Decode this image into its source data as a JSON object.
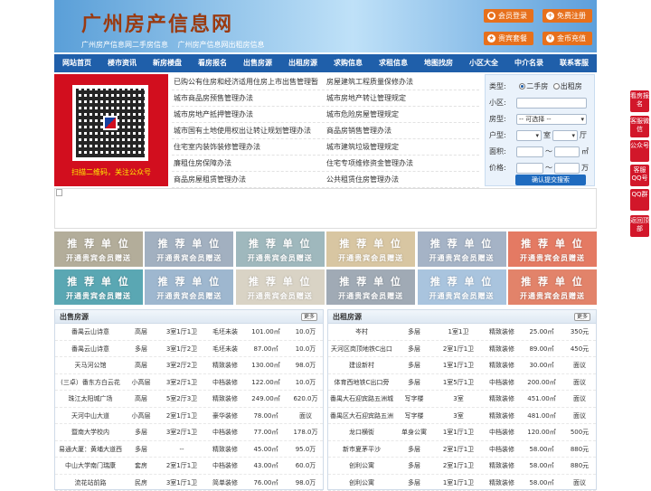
{
  "header": {
    "logo": "广州房产信息网",
    "slogans": [
      "广州房产信息网二手房信息",
      "广州房产信息网出租房信息"
    ],
    "buttons": [
      {
        "label": "会员登录",
        "icon": "user-icon"
      },
      {
        "label": "免费注册",
        "icon": "register-icon"
      },
      {
        "label": "贵宾套餐",
        "icon": "vip-icon"
      },
      {
        "label": "金币充值",
        "icon": "coin-icon"
      }
    ],
    "accent": "#e7701c"
  },
  "nav": [
    "网站首页",
    "楼市资讯",
    "新房楼盘",
    "看房报名",
    "出售房源",
    "出租房源",
    "求购信息",
    "求租信息",
    "地图找房",
    "小区大全",
    "中介名录",
    "联系客服"
  ],
  "qr": {
    "caption": "扫描二维码，关注公众号"
  },
  "links": [
    [
      "已购公有住房和经济适用住房上市出售管理暂",
      "房屋建筑工程质量保修办法"
    ],
    [
      "城市商品房预售管理办法",
      "城市房地产转让管理规定"
    ],
    [
      "城市房地产抵押管理办法",
      "城市危险房屋管理规定"
    ],
    [
      "城市国有土地使用权出让转让规划管理办法",
      "商品房销售管理办法"
    ],
    [
      "住宅室内装饰装修管理办法",
      "城市建筑垃圾管理规定"
    ],
    [
      "廉租住房保障办法",
      "住宅专项维修资金管理办法"
    ],
    [
      "商品房屋租赁管理办法",
      "公共租赁住房管理办法"
    ]
  ],
  "search": {
    "type_label": "类型:",
    "opt1": "二手房",
    "opt2": "出租房",
    "community_label": "小区:",
    "housing_label": "房型:",
    "housing_value": "-- 可选择 --",
    "layout_label": "户型:",
    "room_unit": "室",
    "hall_unit": "厅",
    "area_label": "面积:",
    "area_sep": "～",
    "area_unit": "㎡",
    "price_label": "价格:",
    "price_sep": "～",
    "price_unit": "万",
    "submit": "确认提交搜索"
  },
  "promo": {
    "title": "推 荐 单 位",
    "subtitle": "开通贵宾会员赠送",
    "colors": [
      "#b3ad9a",
      "#a2b0c0",
      "#9fb8bd",
      "#d8c6a2",
      "#a5b3c6",
      "#e47a63",
      "#5aa7b3",
      "#9eb7cf",
      "#d9d3c5",
      "#a0aab5",
      "#a9c4de",
      "#e2836a"
    ]
  },
  "sale": {
    "title": "出售房源",
    "more": "更多",
    "rows": [
      [
        "番禺云山诗意",
        "高层",
        "3室1厅1卫",
        "毛坯未装",
        "101.00㎡",
        "10.0万"
      ],
      [
        "番禺云山诗意",
        "多层",
        "3室1厅2卫",
        "毛坯未装",
        "87.00㎡",
        "10.0万"
      ],
      [
        "天马河公馆",
        "高层",
        "3室2厅2卫",
        "精致装修",
        "130.00㎡",
        "98.0万"
      ],
      [
        "(三卓）番东方白云花",
        "小高层",
        "3室2厅1卫",
        "中档装修",
        "122.00㎡",
        "10.0万"
      ],
      [
        "珠江太阳城广场",
        "高层",
        "5室2厅3卫",
        "精致装修",
        "249.00㎡",
        "620.0万"
      ],
      [
        "天河中山大道",
        "小高层",
        "2室1厅1卫",
        "豪华装修",
        "78.00㎡",
        "面议"
      ],
      [
        "暨南大学校内",
        "多层",
        "3室2厅1卫",
        "中档装修",
        "77.00㎡",
        "178.0万"
      ],
      [
        "易通大厦：黄埔大道西",
        "多层",
        "--",
        "精致装修",
        "45.00㎡",
        "95.0万"
      ],
      [
        "中山大学南门瑞康",
        "套房",
        "2室1厅1卫",
        "中档装修",
        "43.00㎡",
        "60.0万"
      ],
      [
        "流花站前路",
        "民房",
        "3室1厅1卫",
        "简单装修",
        "76.00㎡",
        "98.0万"
      ]
    ]
  },
  "rent": {
    "title": "出租房源",
    "more": "更多",
    "rows": [
      [
        "岑村",
        "多层",
        "1室1卫",
        "精致装修",
        "25.00㎡",
        "350元"
      ],
      [
        "天河区岗顶地铁C出口",
        "多层",
        "2室1厅1卫",
        "精致装修",
        "89.00㎡",
        "450元"
      ],
      [
        "建设新村",
        "多层",
        "1室1厅1卫",
        "精致装修",
        "30.00㎡",
        "面议"
      ],
      [
        "体育西地铁C出口旁",
        "多层",
        "1室5厅1卫",
        "中档装修",
        "200.00㎡",
        "面议"
      ],
      [
        "番禺大石迎宾路五洲城",
        "写字楼",
        "3室",
        "精致装修",
        "451.00㎡",
        "面议"
      ],
      [
        "番禺区大石迎宾路五洲",
        "写字楼",
        "3室",
        "精致装修",
        "481.00㎡",
        "面议"
      ],
      [
        "龙口横街",
        "单身公寓",
        "1室1厅1卫",
        "中档装修",
        "120.00㎡",
        "500元"
      ],
      [
        "新市夏茅平沙",
        "多层",
        "2室1厅1卫",
        "中档装修",
        "58.00㎡",
        "880元"
      ],
      [
        "创利公寓",
        "多层",
        "2室1厅1卫",
        "精致装修",
        "58.00㎡",
        "880元"
      ],
      [
        "创利公寓",
        "多层",
        "1室1厅1卫",
        "精致装修",
        "58.00㎡",
        "面议"
      ]
    ]
  },
  "sidebar": [
    "看房报名",
    "客服微信",
    "公众号",
    "客服QQ号",
    "QQ群",
    "返回顶部"
  ]
}
